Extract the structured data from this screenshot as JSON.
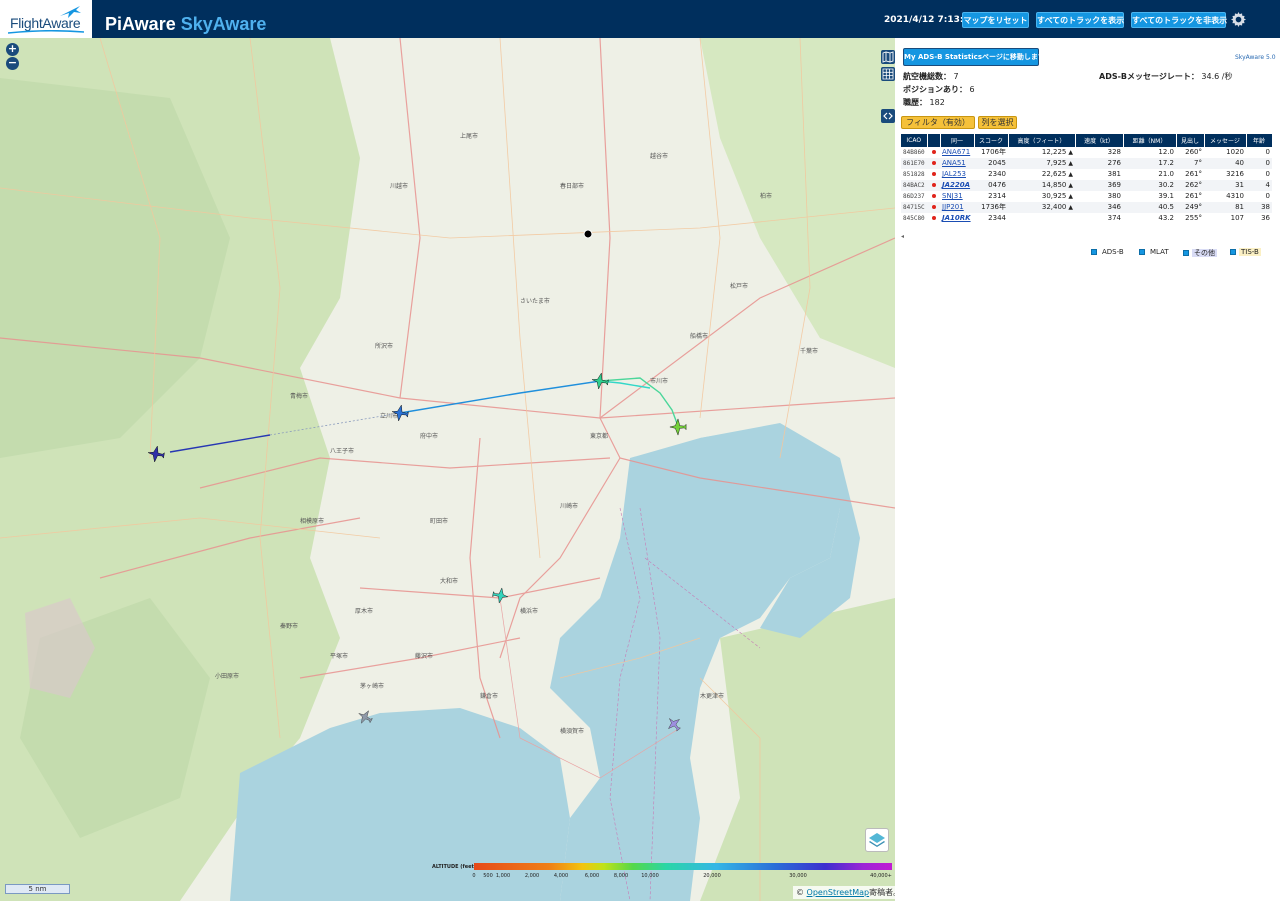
{
  "header": {
    "logo_text": "FlightAware",
    "title_main": "PiAware ",
    "title_accent": "SkyAware",
    "clock": "2021/4/12 7:13:15",
    "btn_reset": "マップをリセット",
    "btn_show_tracks": "すべてのトラックを表示",
    "btn_hide_tracks": "すべてのトラックを非表示"
  },
  "map": {
    "zoom_in": "+",
    "zoom_out": "−",
    "scale_label": "5 nm",
    "attribution_prefix": "© ",
    "attribution_link": "OpenStreetMap",
    "attribution_suffix": "寄稿者。",
    "altitude_label": "ALTITUDE (feet)",
    "altitude_ticks": [
      "0",
      "500",
      "1,000",
      "2,000",
      "4,000",
      "6,000",
      "8,000",
      "10,000",
      "20,000",
      "30,000",
      "40,000+"
    ],
    "city_labels": [
      "川越市",
      "さいたま市",
      "所沢市",
      "東京都",
      "横浜市",
      "川崎市",
      "千葉市",
      "八王子市",
      "相模原市",
      "横須賀市",
      "鎌倉市",
      "町田市",
      "松戸市",
      "船橋市",
      "市川市",
      "厚木市",
      "藤沢市",
      "木更津市",
      "上尾市",
      "春日部市",
      "越谷市",
      "柏市",
      "青梅市",
      "立川市",
      "府中市",
      "大和市",
      "茅ヶ崎市",
      "平塚市",
      "小田原市",
      "秦野市"
    ],
    "colors": {
      "land": "#eef0e6",
      "forest": "#cfe3b8",
      "water": "#aad3df",
      "road_major": "#e8928f",
      "road_minor": "#f3c79d"
    }
  },
  "sidebar": {
    "stats_button": "My ADS-B Statisticsページに移動します",
    "version": "SkyAware 5.0",
    "total_label": "航空機総数：",
    "total_value": "7",
    "rate_label": "ADS-Bメッセージレート：",
    "rate_value": "34.6 /秒",
    "pos_label": "ポジションあり：",
    "pos_value": "6",
    "hist_label": "職歴：",
    "hist_value": "182",
    "filter_button": "フィルタ（有効）",
    "columns_button": "列を選択",
    "columns": [
      "ICAO",
      "",
      "同一",
      "スコーク",
      "高度（フィート）",
      "速度（kt）",
      "距離（NM）",
      "見出し",
      "メッセージ",
      "年齢"
    ],
    "rows": [
      {
        "icao": "84B860",
        "flight": "ANA671",
        "bold": false,
        "squawk": "1706年",
        "altitude": "12,225",
        "arrow": "▲",
        "speed": "328",
        "distance": "12.0",
        "heading": "260°",
        "messages": "1020",
        "age": "0"
      },
      {
        "icao": "861E70",
        "flight": "ANA51",
        "bold": false,
        "squawk": "2045",
        "altitude": "7,925",
        "arrow": "▲",
        "speed": "276",
        "distance": "17.2",
        "heading": "7°",
        "messages": "40",
        "age": "0"
      },
      {
        "icao": "851828",
        "flight": "JAL253",
        "bold": false,
        "squawk": "2340",
        "altitude": "22,625",
        "arrow": "▲",
        "speed": "381",
        "distance": "21.0",
        "heading": "261°",
        "messages": "3216",
        "age": "0"
      },
      {
        "icao": "84BAC2",
        "flight": "JA220A",
        "bold": true,
        "squawk": "0476",
        "altitude": "14,850",
        "arrow": "▲",
        "speed": "369",
        "distance": "30.2",
        "heading": "262°",
        "messages": "31",
        "age": "4"
      },
      {
        "icao": "86D237",
        "flight": "SNJ31",
        "bold": false,
        "squawk": "2314",
        "altitude": "30,925",
        "arrow": "▲",
        "speed": "380",
        "distance": "39.1",
        "heading": "261°",
        "messages": "4310",
        "age": "0"
      },
      {
        "icao": "84715C",
        "flight": "JJP201",
        "bold": false,
        "squawk": "1736年",
        "altitude": "32,400",
        "arrow": "▲",
        "speed": "346",
        "distance": "40.5",
        "heading": "249°",
        "messages": "81",
        "age": "38"
      },
      {
        "icao": "845C80",
        "flight": "JA10RK",
        "bold": true,
        "squawk": "2344",
        "altitude": "",
        "arrow": "",
        "speed": "374",
        "distance": "43.2",
        "heading": "255°",
        "messages": "107",
        "age": "36"
      }
    ],
    "scroll_hint": "◂",
    "legend": [
      "ADS-B",
      "MLAT",
      "その他",
      "TIS-B"
    ]
  }
}
